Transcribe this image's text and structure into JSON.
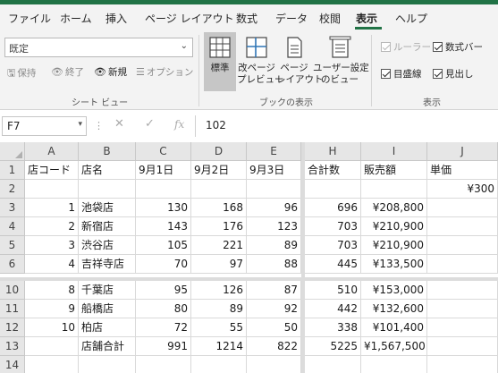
{
  "menu": {
    "tabs": [
      {
        "label": "ファイル",
        "active": false
      },
      {
        "label": "ホーム",
        "active": false
      },
      {
        "label": "挿入",
        "active": false
      },
      {
        "label": "ページ レイアウト",
        "active": false
      },
      {
        "label": "数式",
        "active": false
      },
      {
        "label": "データ",
        "active": false
      },
      {
        "label": "校閲",
        "active": false
      },
      {
        "label": "表示",
        "active": true
      },
      {
        "label": "ヘルプ",
        "active": false
      }
    ]
  },
  "ribbon": {
    "sheet_view": {
      "select_value": "既定",
      "keep_label": "保持",
      "exit_label": "終了",
      "new_label": "新規",
      "options_label": "オプション",
      "group_label": "シート ビュー"
    },
    "workbook_views": {
      "normal_label": "標準",
      "page_break_label": "改ページ\nプレビュー",
      "page_layout_label": "ページ\nレイアウト",
      "custom_label": "ユーザー設定\nのビュー",
      "group_label": "ブックの表示"
    },
    "show": {
      "ruler_label": "ルーラー",
      "formula_bar_label": "数式バー",
      "gridlines_label": "目盛線",
      "headings_label": "見出し",
      "group_label": "表示"
    }
  },
  "formula_bar": {
    "name_box": "F7",
    "cancel_icon": "✕",
    "enter_icon": "✓",
    "fx_label": "fx",
    "value": "102"
  },
  "sheet": {
    "columns": [
      "A",
      "B",
      "C",
      "D",
      "E",
      "H",
      "I",
      "J"
    ],
    "rows": [
      {
        "num": "1",
        "cells": [
          "店コード",
          "店名",
          "9月1日",
          "9月2日",
          "9月3日",
          "合計数",
          "販売額",
          "単価"
        ]
      },
      {
        "num": "2",
        "cells": [
          "",
          "",
          "",
          "",
          "",
          "",
          "",
          "¥300"
        ]
      },
      {
        "num": "3",
        "cells": [
          "1",
          "池袋店",
          "130",
          "168",
          "96",
          "696",
          "¥208,800",
          ""
        ]
      },
      {
        "num": "4",
        "cells": [
          "2",
          "新宿店",
          "143",
          "176",
          "123",
          "703",
          "¥210,900",
          ""
        ]
      },
      {
        "num": "5",
        "cells": [
          "3",
          "渋谷店",
          "105",
          "221",
          "89",
          "703",
          "¥210,900",
          ""
        ]
      },
      {
        "num": "6",
        "cells": [
          "4",
          "吉祥寺店",
          "70",
          "97",
          "88",
          "445",
          "¥133,500",
          ""
        ]
      },
      {
        "num": "10",
        "cells": [
          "8",
          "千葉店",
          "95",
          "126",
          "87",
          "510",
          "¥153,000",
          ""
        ]
      },
      {
        "num": "11",
        "cells": [
          "9",
          "船橋店",
          "80",
          "89",
          "92",
          "442",
          "¥132,600",
          ""
        ]
      },
      {
        "num": "12",
        "cells": [
          "10",
          "柏店",
          "72",
          "55",
          "50",
          "338",
          "¥101,400",
          ""
        ]
      },
      {
        "num": "13",
        "cells": [
          "",
          "店舗合計",
          "991",
          "1214",
          "822",
          "5225",
          "¥1,567,500",
          ""
        ]
      },
      {
        "num": "14",
        "cells": [
          "",
          "",
          "",
          "",
          "",
          "",
          "",
          ""
        ]
      }
    ]
  },
  "colors": {
    "accent": "#217346",
    "ribbon_bg": "#f3f3f3",
    "header_bg": "#e6e6e6"
  }
}
